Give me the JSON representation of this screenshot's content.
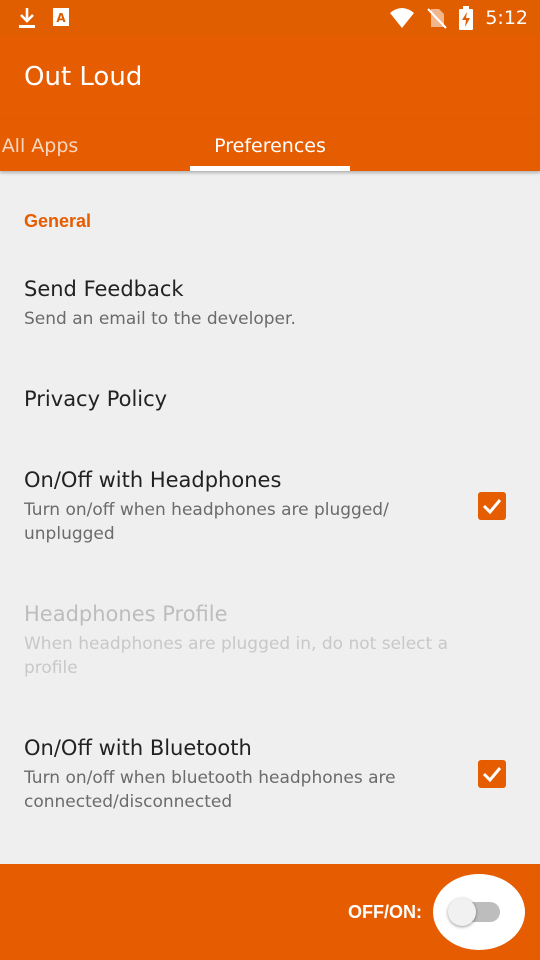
{
  "status_bar": {
    "time": "5:12",
    "icons": [
      "download-icon",
      "font-app-icon",
      "wifi-icon",
      "no-sim-icon",
      "battery-charging-icon"
    ]
  },
  "app_bar": {
    "title": "Out Loud"
  },
  "tabs": [
    {
      "label": "All Apps",
      "selected": false
    },
    {
      "label": "Preferences",
      "selected": true
    }
  ],
  "preferences": {
    "section_header": "General",
    "items": [
      {
        "title": "Send Feedback",
        "summary": "Send an email to the developer."
      },
      {
        "title": "Privacy Policy"
      },
      {
        "title": "On/Off with Headphones",
        "summary": "Turn on/off when headphones are plugged/ unplugged",
        "checked": true
      },
      {
        "title": "Headphones Profile",
        "summary": "When headphones are plugged in, do not select a profile",
        "enabled": false
      },
      {
        "title": "On/Off with Bluetooth",
        "summary": "Turn on/off when bluetooth headphones are connected/disconnected",
        "checked": true
      }
    ]
  },
  "bottom_bar": {
    "label": "OFF/ON:",
    "switch_on": false
  },
  "colors": {
    "accent": "#e65c00",
    "status_bar": "#e05d00",
    "background": "#efefef"
  }
}
